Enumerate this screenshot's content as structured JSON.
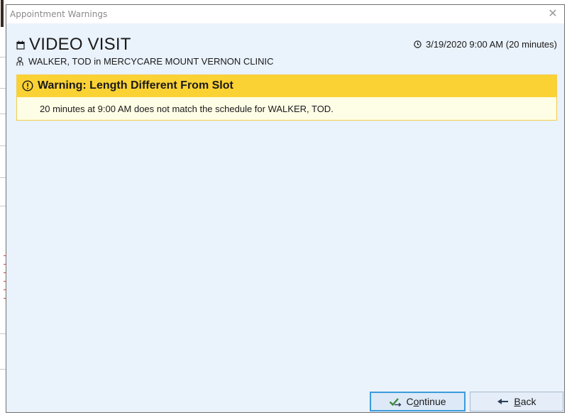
{
  "window": {
    "title": "Appointment Warnings",
    "close_glyph": "✕"
  },
  "appointment": {
    "visit_type": "VIDEO VISIT",
    "datetime": "3/19/2020 9:00 AM (20 minutes)",
    "patient_line": "WALKER, TOD in MERCYCARE MOUNT VERNON CLINIC",
    "icons": {
      "visit": "calendar-icon",
      "datetime": "clock-icon",
      "patient": "person-icon"
    }
  },
  "warning": {
    "title": "Warning: Length Different From Slot",
    "message": "20 minutes at 9:00 AM does not match the schedule for WALKER, TOD.",
    "icon": "exclamation-circle-icon",
    "header_color": "#fbd234",
    "body_color": "#fefde6"
  },
  "buttons": {
    "continue": {
      "label_pre": "C",
      "label_accel": "o",
      "label_post": "ntinue",
      "icon": "checkmark-arrow-icon"
    },
    "back": {
      "label_pre": "",
      "label_accel": "B",
      "label_post": "ack",
      "icon": "left-arrow-icon"
    }
  },
  "colors": {
    "window_bg": "#eaf2fb",
    "accent_focus": "#3b9bdc"
  }
}
